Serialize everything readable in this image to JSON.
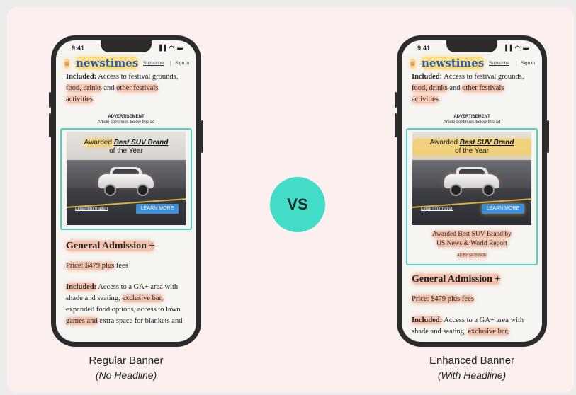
{
  "status": {
    "time": "9:41",
    "icons": "▐▐ ◠ ▬"
  },
  "nav": {
    "menu": "≡",
    "logo": "newstimes",
    "subscribe": "Subscribe",
    "signin": "Sign in"
  },
  "top_text": {
    "line1_a": "Included:",
    "line1_b": " Access to festival grounds,",
    "line2_a": "food, drinks",
    "line2_b": " and ",
    "line2_c": "other festivals",
    "line3": "activities",
    "line3_end": "."
  },
  "ad_header": {
    "title": "ADVERTISEMENT",
    "sub": "Article continues below this ad"
  },
  "ad": {
    "title_pre": "Awarded ",
    "title_em": "Best SUV Brand",
    "title_post": "of the Year",
    "legal": "Legal information",
    "cta": "LEARN MORE"
  },
  "enhanced": {
    "headline_1": "Awarded Best SUV Brand by",
    "headline_2": "US News & World Report",
    "byline": "AD BY SPONSOR"
  },
  "section": {
    "heading": "General Admission +",
    "price_a": "Price: $479 plus",
    "price_b": " fees",
    "inc_a": "Included:",
    "inc_b": " Access to a GA+ area with",
    "inc2_a": "shade and seating, ",
    "inc2_b": "exclusive bar,",
    "inc3": "expanded food options, access to lawn",
    "inc4_a": "games and",
    "inc4_b": " extra space for blankets and"
  },
  "vs": "VS",
  "labels": {
    "left_title": "Regular Banner",
    "left_sub": "(No Headline)",
    "right_title": "Enhanced Banner",
    "right_sub": "(With Headline)"
  }
}
